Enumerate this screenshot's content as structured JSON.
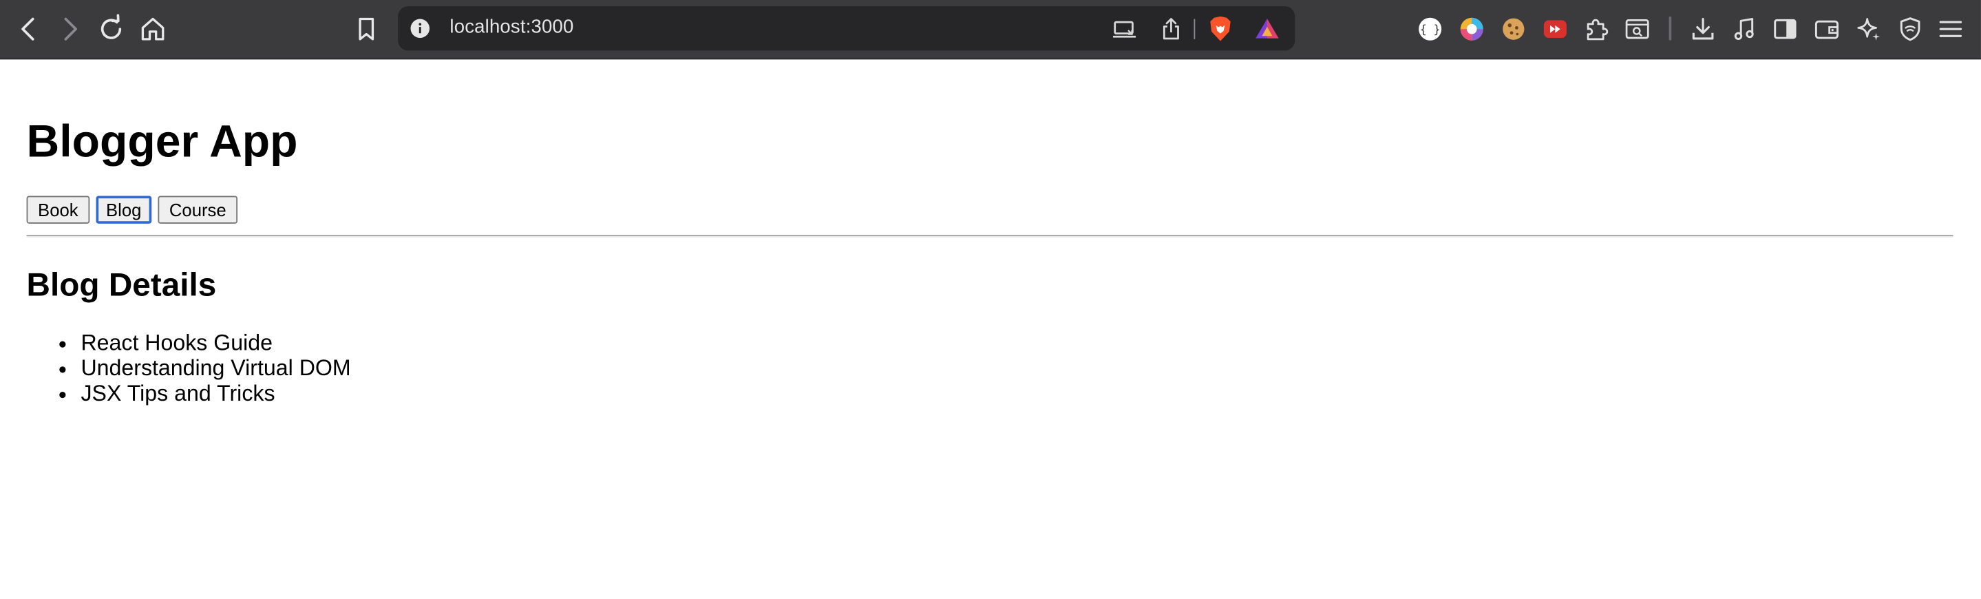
{
  "browser": {
    "url": "localhost:3000",
    "icons": {
      "back": "back-arrow-icon",
      "forward": "forward-arrow-icon",
      "reload": "reload-icon",
      "home": "home-icon",
      "bookmark": "bookmark-icon",
      "site_info": "info-icon",
      "cast": "cast-icon",
      "share": "share-icon",
      "brave_shields": "brave-lion-icon",
      "brave_rewards": "brave-rewards-triangle-icon",
      "extensions": [
        "json-viewer-icon",
        "color-picker-icon",
        "cookie-icon",
        "video-speed-icon",
        "puzzle-extensions-icon",
        "search-screen-icon"
      ],
      "right": [
        "download-icon",
        "music-icon",
        "sidebar-icon",
        "wallet-icon",
        "leo-ai-icon",
        "vpn-shield-icon",
        "menu-icon"
      ]
    },
    "colors": {
      "toolbar": "#3b3b3e",
      "urlbar": "#262628",
      "brave_orange": "#fb542b"
    }
  },
  "app": {
    "title": "Blogger App",
    "nav": {
      "book": "Book",
      "blog": "Blog",
      "course": "Course",
      "focused": "Blog"
    },
    "section_title": "Blog Details",
    "blogs": [
      "React Hooks Guide",
      "Understanding Virtual DOM",
      "JSX Tips and Tricks"
    ]
  }
}
